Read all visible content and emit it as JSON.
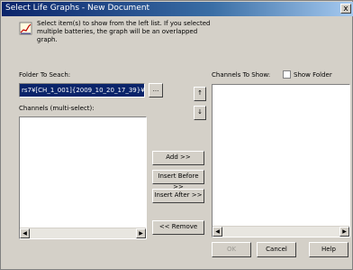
{
  "window": {
    "title": "Select Life Graphs - New Document",
    "close_glyph": "x"
  },
  "description": {
    "line1": "Select item(s) to show from the left list.  If you selected",
    "line2": "multiple batteries, the graph will be an overlapped",
    "line3": "graph."
  },
  "labels": {
    "folder_to_search": "Folder To Seach:",
    "channels_multiselect": "Channels (multi-select):",
    "channels_to_show": "Channels To Show:",
    "show_folder": "Show Folder"
  },
  "folder_field": {
    "value": "rs7¥[CH_1_001]{2009_10_20_17_39}¥"
  },
  "buttons": {
    "browse": "...",
    "up": "↑",
    "down": "↓",
    "add": "Add >>",
    "insert_before": "Insert Before >>",
    "insert_after": "Insert After >>",
    "remove": "<< Remove",
    "ok": "OK",
    "cancel": "Cancel",
    "help": "Help"
  },
  "scroll": {
    "left": "◀",
    "right": "▶"
  },
  "colors": {
    "titlebar_start": "#0a246a",
    "titlebar_end": "#a6caf0",
    "dialog_bg": "#d4d0c8",
    "selection_bg": "#0a246a"
  }
}
